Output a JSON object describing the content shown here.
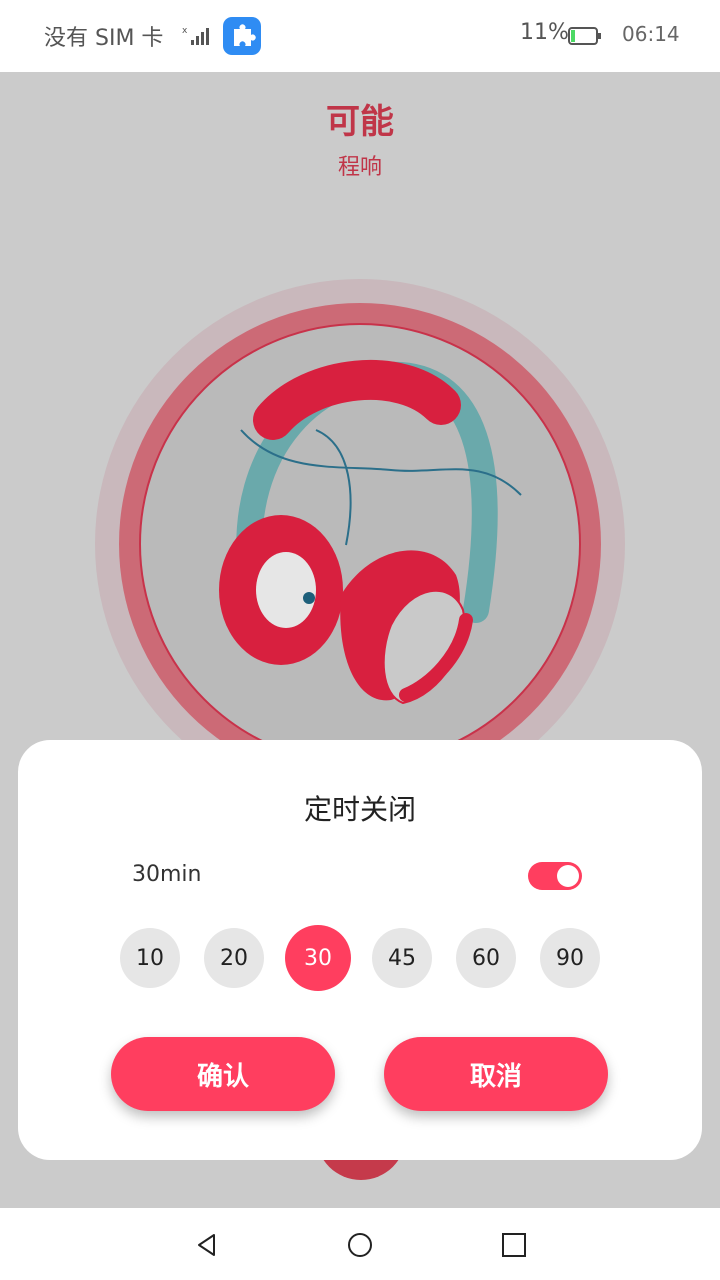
{
  "status_bar": {
    "carrier": "没有 SIM 卡",
    "battery_percent": "11%",
    "time": "06:14",
    "icons": [
      "signal-icon",
      "puzzle-app-icon",
      "battery-icon"
    ]
  },
  "player": {
    "song_title": "可能",
    "artist": "程响",
    "cover_icon": "headphones-illustration"
  },
  "timer_dialog": {
    "title": "定时关闭",
    "current_value": "30min",
    "toggle_on": true,
    "options": [
      "10",
      "20",
      "30",
      "45",
      "60",
      "90"
    ],
    "selected_option": "30",
    "confirm_label": "确认",
    "cancel_label": "取消"
  },
  "nav_bar": {
    "icons": [
      "back-icon",
      "home-icon",
      "recents-icon"
    ]
  },
  "colors": {
    "accent": "#ff3e5f",
    "title_red": "#c03548",
    "overlay_bg": "#cbcbcb"
  }
}
